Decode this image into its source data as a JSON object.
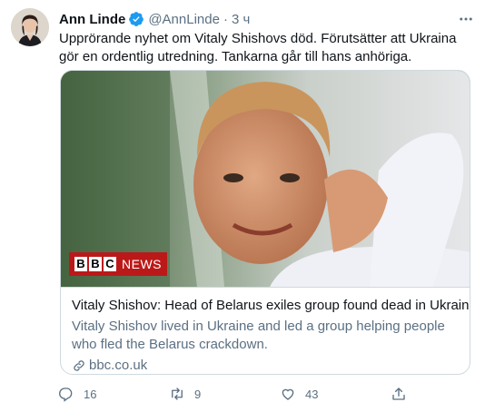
{
  "author": {
    "name": "Ann Linde",
    "handle": "@AnnLinde",
    "separator": "·",
    "time": "3 ч",
    "avatar_icon": "profile-photo"
  },
  "tweet": {
    "text": "Upprörande nyhet om Vitaly Shishovs död. Förutsätter att Ukraina gör en ordentlig utredning. Tankarna går till hans anhöriga."
  },
  "card": {
    "badge_box_1": "B",
    "badge_box_2": "B",
    "badge_box_3": "C",
    "badge_news": "NEWS",
    "title": "Vitaly Shishov: Head of Belarus exiles group found dead in Ukraine",
    "description": "Vitaly Shishov lived in Ukraine and led a group helping people who fled the Belarus crackdown.",
    "domain": "bbc.co.uk"
  },
  "actions": {
    "replies": "16",
    "retweets": "9",
    "likes": "43"
  },
  "colors": {
    "verified": "#1d9bf0",
    "muted": "#5b7083",
    "border": "#cfd9de",
    "bbc_red": "#bb1919"
  }
}
